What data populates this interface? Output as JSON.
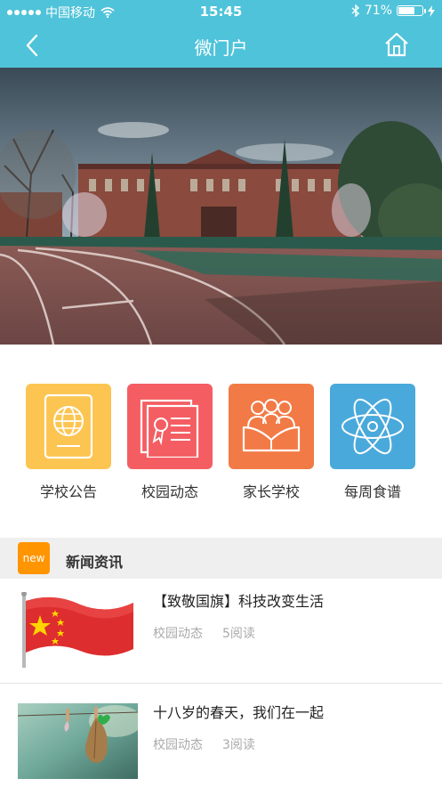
{
  "status_bar": {
    "carrier": "中国移动",
    "time": "15:45",
    "battery": "71%",
    "battery_level": 0.71
  },
  "nav": {
    "title": "微门户",
    "back_icon": "chevron-left-icon",
    "home_icon": "home-icon"
  },
  "quick_menu": [
    {
      "label": "学校公告",
      "color": "#fcc552",
      "icon": "passport-icon"
    },
    {
      "label": "校园动态",
      "color": "#f45e63",
      "icon": "certificate-icon"
    },
    {
      "label": "家长学校",
      "color": "#f27a46",
      "icon": "family-book-icon"
    },
    {
      "label": "每周食谱",
      "color": "#4aa9db",
      "icon": "atom-icon"
    }
  ],
  "news": {
    "badge": "new",
    "section_title": "新闻资讯",
    "items": [
      {
        "title": "【致敬国旗】科技改变生活",
        "category": "校园动态",
        "reads": "5阅读"
      },
      {
        "title": "十八岁的春天，我们在一起",
        "category": "校园动态",
        "reads": "3阅读"
      }
    ]
  }
}
